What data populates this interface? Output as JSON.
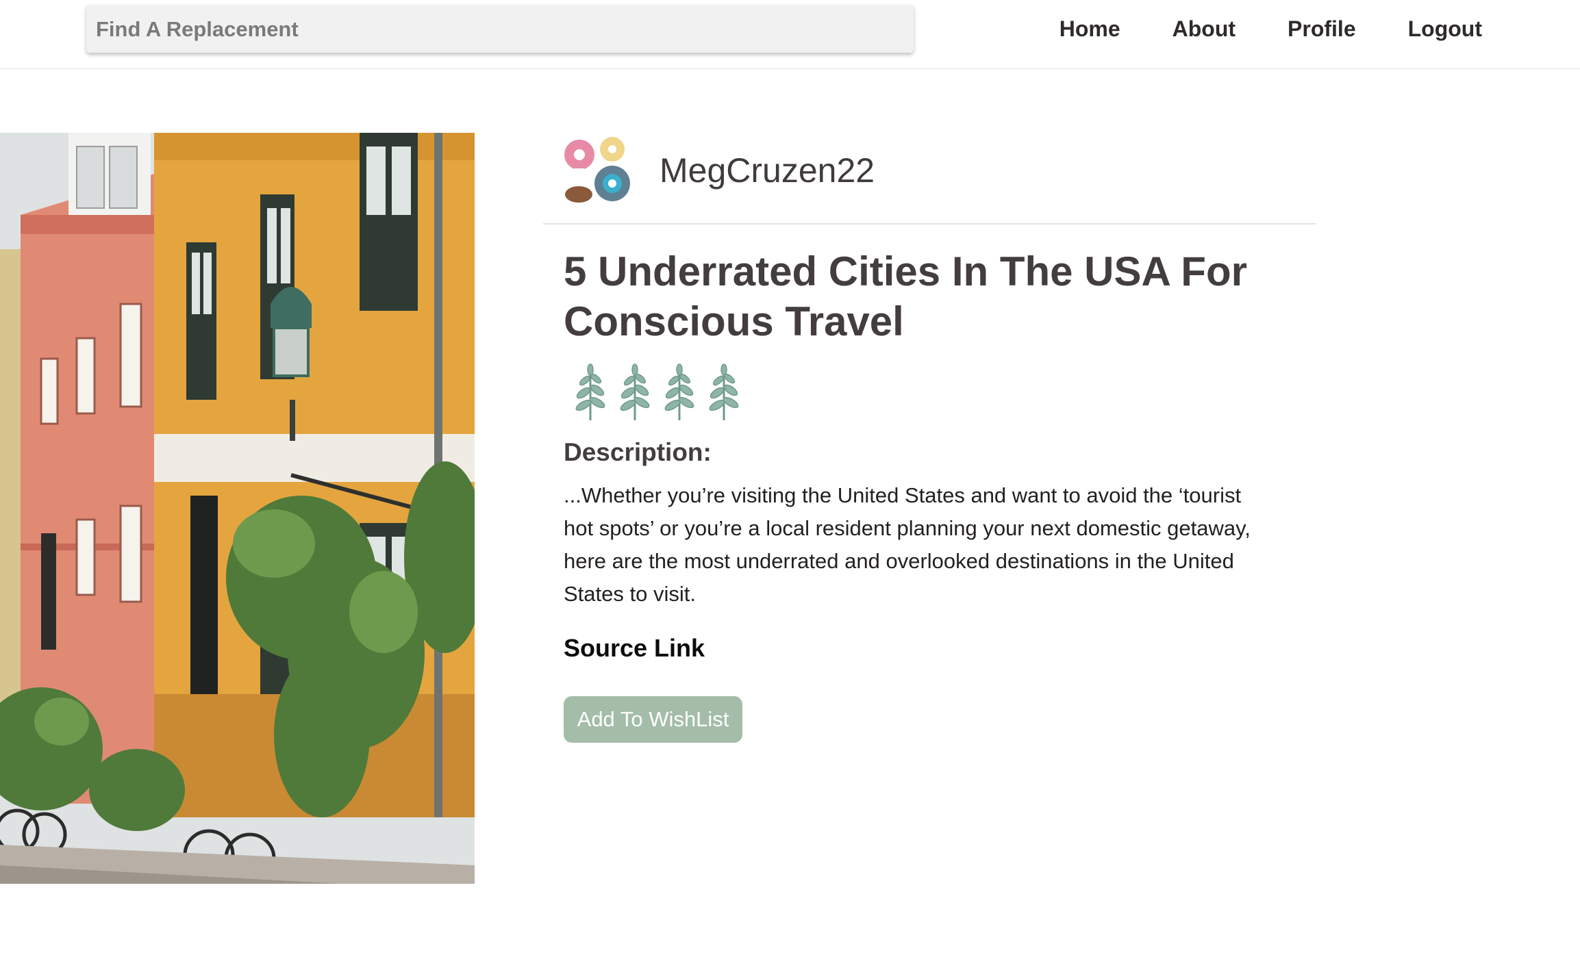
{
  "search": {
    "placeholder": "Find A Replacement"
  },
  "nav": {
    "items": [
      {
        "label": "Home"
      },
      {
        "label": "About"
      },
      {
        "label": "Profile"
      },
      {
        "label": "Logout"
      }
    ]
  },
  "hero": {
    "image": "colorful-street-houses-photo"
  },
  "author": {
    "username": "MegCruzen22",
    "avatar": "donut-sticker-avatar"
  },
  "article": {
    "title": "5 Underrated Cities In The USA For Conscious Travel",
    "rating": {
      "value": 4,
      "icon": "leaf-sprig-icon"
    },
    "description_label": "Description:",
    "description": "...Whether you’re visiting the United States and want to avoid the ‘tourist hot spots’ or you’re a local resident planning your next domestic getaway, here are the most underrated and overlooked destinations in the United States to visit.",
    "source_link_label": "Source Link",
    "wishlist_button_label": "Add To WishList"
  },
  "colors": {
    "accent_button": "#a3bda8",
    "title_text": "#433d40",
    "leaf_green": "#7fa89a"
  }
}
